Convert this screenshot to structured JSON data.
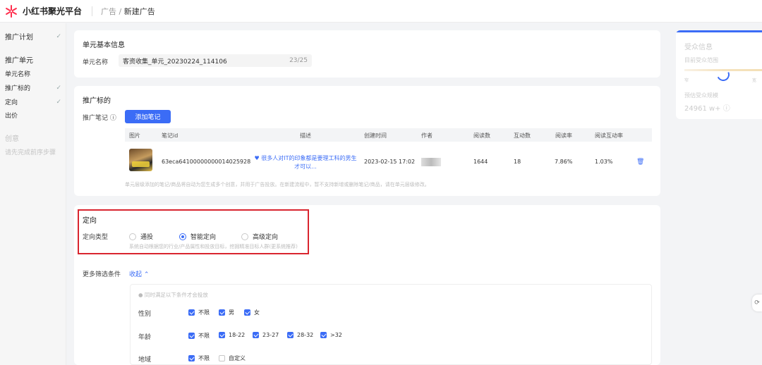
{
  "brand": {
    "name": "小红书聚光平台",
    "accent": "#ff2e4d",
    "primary": "#3b6cf6",
    "alert": "#d9252f"
  },
  "breadcrumb": {
    "parent": "广告",
    "sep": "/",
    "current": "新建广告"
  },
  "sidebar": {
    "items": [
      {
        "label": "推广计划",
        "done": true
      },
      {
        "label": "推广单元",
        "done": false
      },
      {
        "label": "单元名称",
        "done": false
      },
      {
        "label": "推广标的",
        "done": true
      },
      {
        "label": "定向",
        "done": true
      },
      {
        "label": "出价",
        "done": false
      },
      {
        "label": "创意",
        "done": false
      },
      {
        "label": "请先完成前序步骤",
        "done": false
      }
    ],
    "check_glyph": "✓"
  },
  "basic": {
    "title": "单元基本信息",
    "name_label": "单元名称",
    "name_value": "客资收集_单元_20230224_114106",
    "name_count": "23/25"
  },
  "target": {
    "title": "推广标的",
    "note_label": "推广笔记",
    "info_icon": "ⓘ",
    "add_button": "添加笔记",
    "columns": [
      "图片",
      "笔记id",
      "描述",
      "创建时间",
      "作者",
      "阅读数",
      "互动数",
      "阅读率",
      "阅读互动率"
    ],
    "row": {
      "id": "63eca64100000000014025928",
      "desc": "♥ 很多人对IT的印象都是要理工科的男生才可以...",
      "created": "2023-02-15 17:02",
      "reads": "1644",
      "interactions": "18",
      "read_rate": "7.86%",
      "interaction_rate": "1.03%"
    },
    "trash_glyph": "🗑",
    "hint": "单元层级添加的笔记/商品将自动为您生成多个创意，并用于广告投放。在新建流程中，暂不支持新增或删除笔记/商品，请在单元层级修改。"
  },
  "targeting": {
    "title": "定向",
    "type_label": "定向类型",
    "options": [
      {
        "label": "通投",
        "checked": false
      },
      {
        "label": "智能定向",
        "checked": true
      },
      {
        "label": "高级定向",
        "checked": false
      }
    ],
    "hint": "系统自动根据您的行业/产品属性和投放目标，挖掘精准目标人群(更系统推荐)",
    "more_label": "更多筛选条件",
    "collapse": "收起 ⌃",
    "filter_hint": "● 同时满足以下条件才会投放",
    "gender": {
      "label": "性别",
      "options": [
        {
          "label": "不限",
          "checked": true
        },
        {
          "label": "男",
          "checked": true
        },
        {
          "label": "女",
          "checked": true
        }
      ]
    },
    "age": {
      "label": "年龄",
      "options": [
        {
          "label": "不限",
          "checked": true
        },
        {
          "label": "18-22",
          "checked": true
        },
        {
          "label": "23-27",
          "checked": true
        },
        {
          "label": "28-32",
          "checked": true
        },
        {
          "label": ">32",
          "checked": true
        }
      ]
    },
    "region": {
      "label": "地域",
      "options": [
        {
          "label": "不限",
          "checked": true
        },
        {
          "label": "自定义",
          "checked": false
        }
      ]
    }
  },
  "audience": {
    "title": "受众信息",
    "range_label": "目前受众范围",
    "narrow": "窄",
    "wide": "宽",
    "estimate_label": "预估受众规模",
    "estimate_value": "24961 w+ ⓘ"
  },
  "float_glyph": "⟳"
}
